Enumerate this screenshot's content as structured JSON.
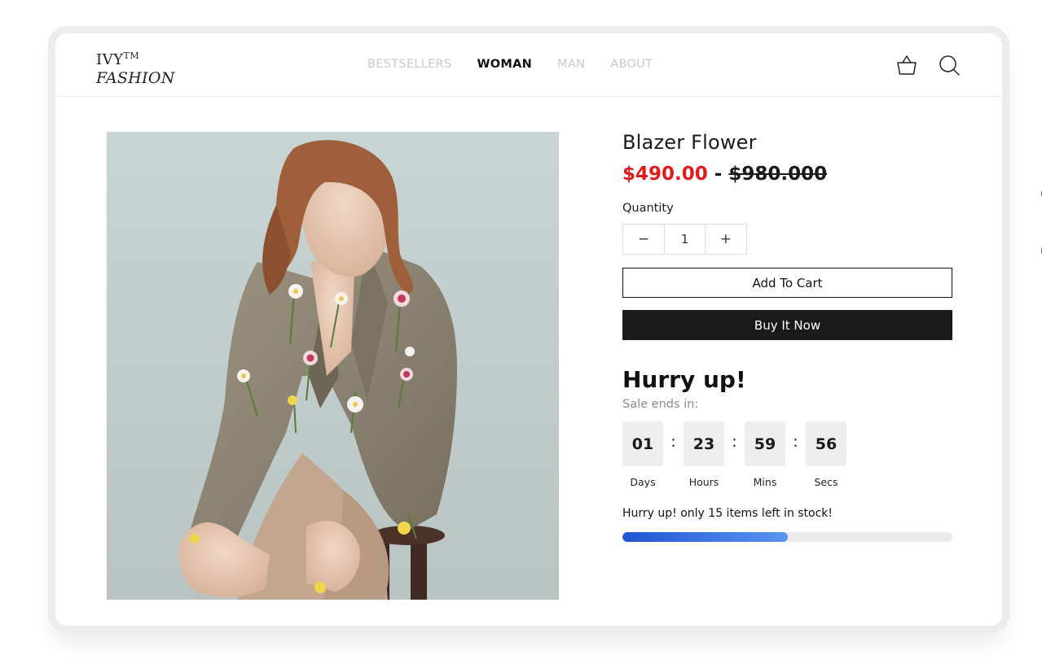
{
  "brand": {
    "line1": "IVY",
    "tm": "TM",
    "line2": "FASHION"
  },
  "nav": {
    "items": [
      {
        "label": "BESTSELLERS",
        "active": false
      },
      {
        "label": "WOMAN",
        "active": true
      },
      {
        "label": "MAN",
        "active": false
      },
      {
        "label": "ABOUT",
        "active": false
      }
    ]
  },
  "header_icons": [
    "basket-icon",
    "search-icon"
  ],
  "product": {
    "title": "Blazer Flower",
    "sale_price": "$490.00",
    "separator": " - ",
    "original_price": "$980.000",
    "image": "woman in tweed blazer decorated with flowers"
  },
  "quantity": {
    "label": "Quantity",
    "minus": "−",
    "value": "1",
    "plus": "+"
  },
  "buttons": {
    "add_to_cart": "Add To Cart",
    "buy_now": "Buy It Now"
  },
  "countdown": {
    "heading": "Hurry up!",
    "subtitle": "Sale ends in:",
    "separator": ":",
    "units": [
      {
        "value": "01",
        "label": "Days"
      },
      {
        "value": "23",
        "label": "Hours"
      },
      {
        "value": "59",
        "label": "Mins"
      },
      {
        "value": "56",
        "label": "Secs"
      }
    ]
  },
  "stock": {
    "message": "Hurry up! only 15 items left in stock!",
    "progress_fraction": 0.5
  },
  "colors": {
    "sale_red": "#e11b1b",
    "dark_button": "#1a1a1a",
    "progress_start": "#1e56d4",
    "progress_end": "#5a95f0"
  }
}
